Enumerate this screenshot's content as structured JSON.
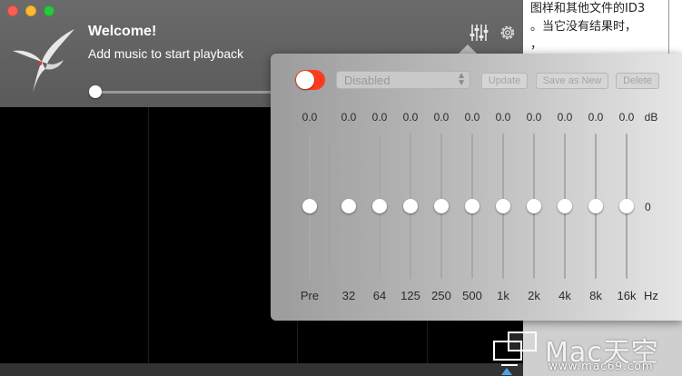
{
  "background_doc": {
    "lines": [
      "图样和其他文件的ID3",
      "。当它没有结果时，",
      "，"
    ]
  },
  "player": {
    "title": "Welcome!",
    "subtitle": "Add music to start playback",
    "progress": 0
  },
  "equalizer": {
    "enabled": false,
    "preset_selected": "Disabled",
    "buttons": {
      "update": "Update",
      "save_as_new": "Save as New",
      "delete": "Delete"
    },
    "db_unit": "dB",
    "hz_unit": "Hz",
    "zero_label": "0",
    "bands": [
      {
        "label": "Pre",
        "value": "0.0"
      },
      {
        "label": "32",
        "value": "0.0"
      },
      {
        "label": "64",
        "value": "0.0"
      },
      {
        "label": "125",
        "value": "0.0"
      },
      {
        "label": "250",
        "value": "0.0"
      },
      {
        "label": "500",
        "value": "0.0"
      },
      {
        "label": "1k",
        "value": "0.0"
      },
      {
        "label": "2k",
        "value": "0.0"
      },
      {
        "label": "4k",
        "value": "0.0"
      },
      {
        "label": "8k",
        "value": "0.0"
      },
      {
        "label": "16k",
        "value": "0.0"
      }
    ]
  },
  "watermark": {
    "text": "Mac天空",
    "url": "www.mac69.com"
  },
  "colors": {
    "toggle_off_accent": "#ff3b1f",
    "titlebar": "#646464",
    "arrow_accent": "#4aa3e8"
  },
  "icons": [
    "equalizer-icon",
    "gear-icon",
    "hummingbird-logo",
    "chevron-updown-icon"
  ]
}
